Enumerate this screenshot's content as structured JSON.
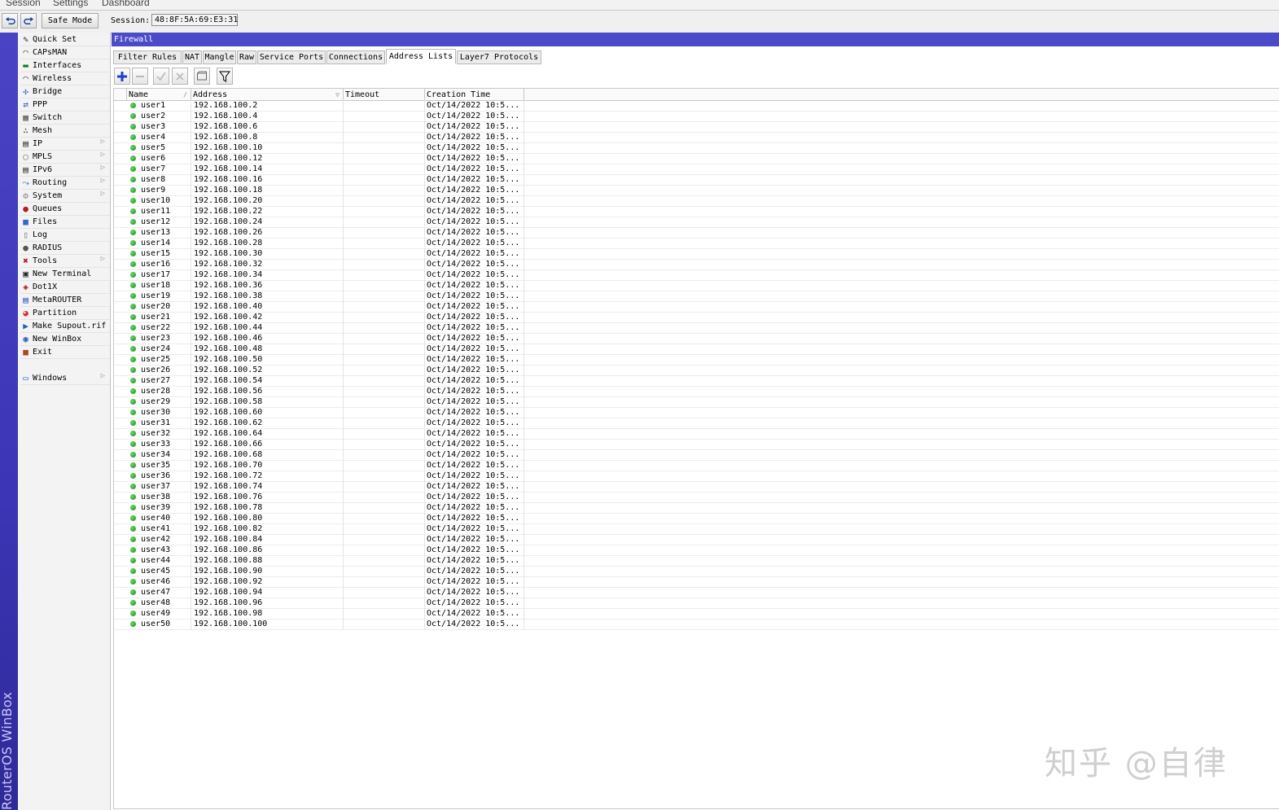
{
  "menu": [
    "Session",
    "Settings",
    "Dashboard"
  ],
  "toolbar": {
    "safe_mode": "Safe Mode",
    "session_label": "Session:",
    "session_value": "48:8F:5A:69:E3:31"
  },
  "brand": "RouterOS WinBox",
  "sidebar": [
    {
      "label": "Quick Set",
      "icon": "quick-set-icon",
      "sub": false
    },
    {
      "label": "CAPsMAN",
      "icon": "capsman-icon",
      "sub": false
    },
    {
      "label": "Interfaces",
      "icon": "interfaces-icon",
      "sub": false
    },
    {
      "label": "Wireless",
      "icon": "wireless-icon",
      "sub": false
    },
    {
      "label": "Bridge",
      "icon": "bridge-icon",
      "sub": false
    },
    {
      "label": "PPP",
      "icon": "ppp-icon",
      "sub": false
    },
    {
      "label": "Switch",
      "icon": "switch-icon",
      "sub": false
    },
    {
      "label": "Mesh",
      "icon": "mesh-icon",
      "sub": false
    },
    {
      "label": "IP",
      "icon": "ip-icon",
      "sub": true
    },
    {
      "label": "MPLS",
      "icon": "mpls-icon",
      "sub": true
    },
    {
      "label": "IPv6",
      "icon": "ipv6-icon",
      "sub": true
    },
    {
      "label": "Routing",
      "icon": "routing-icon",
      "sub": true
    },
    {
      "label": "System",
      "icon": "system-icon",
      "sub": true
    },
    {
      "label": "Queues",
      "icon": "queues-icon",
      "sub": false
    },
    {
      "label": "Files",
      "icon": "files-icon",
      "sub": false
    },
    {
      "label": "Log",
      "icon": "log-icon",
      "sub": false
    },
    {
      "label": "RADIUS",
      "icon": "radius-icon",
      "sub": false
    },
    {
      "label": "Tools",
      "icon": "tools-icon",
      "sub": true
    },
    {
      "label": "New Terminal",
      "icon": "terminal-icon",
      "sub": false
    },
    {
      "label": "Dot1X",
      "icon": "dot1x-icon",
      "sub": false
    },
    {
      "label": "MetaROUTER",
      "icon": "metarouter-icon",
      "sub": false
    },
    {
      "label": "Partition",
      "icon": "partition-icon",
      "sub": false
    },
    {
      "label": "Make Supout.rif",
      "icon": "supout-icon",
      "sub": false
    },
    {
      "label": "New WinBox",
      "icon": "winbox-icon",
      "sub": false
    },
    {
      "label": "Exit",
      "icon": "exit-icon",
      "sub": false
    }
  ],
  "sidebar_windows": {
    "label": "Windows",
    "icon": "windows-icon",
    "sub": true
  },
  "window": {
    "title": "Firewall",
    "tabs": [
      "Filter Rules",
      "NAT",
      "Mangle",
      "Raw",
      "Service Ports",
      "Connections",
      "Address Lists",
      "Layer7 Protocols"
    ],
    "active_tab": "Address Lists"
  },
  "table": {
    "columns": [
      "Name",
      "Address",
      "Timeout",
      "Creation Time"
    ],
    "rows": [
      {
        "name": "user1",
        "address": "192.168.100.2",
        "timeout": "",
        "created": "Oct/14/2022 10:5..."
      },
      {
        "name": "user2",
        "address": "192.168.100.4",
        "timeout": "",
        "created": "Oct/14/2022 10:5..."
      },
      {
        "name": "user3",
        "address": "192.168.100.6",
        "timeout": "",
        "created": "Oct/14/2022 10:5..."
      },
      {
        "name": "user4",
        "address": "192.168.100.8",
        "timeout": "",
        "created": "Oct/14/2022 10:5..."
      },
      {
        "name": "user5",
        "address": "192.168.100.10",
        "timeout": "",
        "created": "Oct/14/2022 10:5..."
      },
      {
        "name": "user6",
        "address": "192.168.100.12",
        "timeout": "",
        "created": "Oct/14/2022 10:5..."
      },
      {
        "name": "user7",
        "address": "192.168.100.14",
        "timeout": "",
        "created": "Oct/14/2022 10:5..."
      },
      {
        "name": "user8",
        "address": "192.168.100.16",
        "timeout": "",
        "created": "Oct/14/2022 10:5..."
      },
      {
        "name": "user9",
        "address": "192.168.100.18",
        "timeout": "",
        "created": "Oct/14/2022 10:5..."
      },
      {
        "name": "user10",
        "address": "192.168.100.20",
        "timeout": "",
        "created": "Oct/14/2022 10:5..."
      },
      {
        "name": "user11",
        "address": "192.168.100.22",
        "timeout": "",
        "created": "Oct/14/2022 10:5..."
      },
      {
        "name": "user12",
        "address": "192.168.100.24",
        "timeout": "",
        "created": "Oct/14/2022 10:5..."
      },
      {
        "name": "user13",
        "address": "192.168.100.26",
        "timeout": "",
        "created": "Oct/14/2022 10:5..."
      },
      {
        "name": "user14",
        "address": "192.168.100.28",
        "timeout": "",
        "created": "Oct/14/2022 10:5..."
      },
      {
        "name": "user15",
        "address": "192.168.100.30",
        "timeout": "",
        "created": "Oct/14/2022 10:5..."
      },
      {
        "name": "user16",
        "address": "192.168.100.32",
        "timeout": "",
        "created": "Oct/14/2022 10:5..."
      },
      {
        "name": "user17",
        "address": "192.168.100.34",
        "timeout": "",
        "created": "Oct/14/2022 10:5..."
      },
      {
        "name": "user18",
        "address": "192.168.100.36",
        "timeout": "",
        "created": "Oct/14/2022 10:5..."
      },
      {
        "name": "user19",
        "address": "192.168.100.38",
        "timeout": "",
        "created": "Oct/14/2022 10:5..."
      },
      {
        "name": "user20",
        "address": "192.168.100.40",
        "timeout": "",
        "created": "Oct/14/2022 10:5..."
      },
      {
        "name": "user21",
        "address": "192.168.100.42",
        "timeout": "",
        "created": "Oct/14/2022 10:5..."
      },
      {
        "name": "user22",
        "address": "192.168.100.44",
        "timeout": "",
        "created": "Oct/14/2022 10:5..."
      },
      {
        "name": "user23",
        "address": "192.168.100.46",
        "timeout": "",
        "created": "Oct/14/2022 10:5..."
      },
      {
        "name": "user24",
        "address": "192.168.100.48",
        "timeout": "",
        "created": "Oct/14/2022 10:5..."
      },
      {
        "name": "user25",
        "address": "192.168.100.50",
        "timeout": "",
        "created": "Oct/14/2022 10:5..."
      },
      {
        "name": "user26",
        "address": "192.168.100.52",
        "timeout": "",
        "created": "Oct/14/2022 10:5..."
      },
      {
        "name": "user27",
        "address": "192.168.100.54",
        "timeout": "",
        "created": "Oct/14/2022 10:5..."
      },
      {
        "name": "user28",
        "address": "192.168.100.56",
        "timeout": "",
        "created": "Oct/14/2022 10:5..."
      },
      {
        "name": "user29",
        "address": "192.168.100.58",
        "timeout": "",
        "created": "Oct/14/2022 10:5..."
      },
      {
        "name": "user30",
        "address": "192.168.100.60",
        "timeout": "",
        "created": "Oct/14/2022 10:5..."
      },
      {
        "name": "user31",
        "address": "192.168.100.62",
        "timeout": "",
        "created": "Oct/14/2022 10:5..."
      },
      {
        "name": "user32",
        "address": "192.168.100.64",
        "timeout": "",
        "created": "Oct/14/2022 10:5..."
      },
      {
        "name": "user33",
        "address": "192.168.100.66",
        "timeout": "",
        "created": "Oct/14/2022 10:5..."
      },
      {
        "name": "user34",
        "address": "192.168.100.68",
        "timeout": "",
        "created": "Oct/14/2022 10:5..."
      },
      {
        "name": "user35",
        "address": "192.168.100.70",
        "timeout": "",
        "created": "Oct/14/2022 10:5..."
      },
      {
        "name": "user36",
        "address": "192.168.100.72",
        "timeout": "",
        "created": "Oct/14/2022 10:5..."
      },
      {
        "name": "user37",
        "address": "192.168.100.74",
        "timeout": "",
        "created": "Oct/14/2022 10:5..."
      },
      {
        "name": "user38",
        "address": "192.168.100.76",
        "timeout": "",
        "created": "Oct/14/2022 10:5..."
      },
      {
        "name": "user39",
        "address": "192.168.100.78",
        "timeout": "",
        "created": "Oct/14/2022 10:5..."
      },
      {
        "name": "user40",
        "address": "192.168.100.80",
        "timeout": "",
        "created": "Oct/14/2022 10:5..."
      },
      {
        "name": "user41",
        "address": "192.168.100.82",
        "timeout": "",
        "created": "Oct/14/2022 10:5..."
      },
      {
        "name": "user42",
        "address": "192.168.100.84",
        "timeout": "",
        "created": "Oct/14/2022 10:5..."
      },
      {
        "name": "user43",
        "address": "192.168.100.86",
        "timeout": "",
        "created": "Oct/14/2022 10:5..."
      },
      {
        "name": "user44",
        "address": "192.168.100.88",
        "timeout": "",
        "created": "Oct/14/2022 10:5..."
      },
      {
        "name": "user45",
        "address": "192.168.100.90",
        "timeout": "",
        "created": "Oct/14/2022 10:5..."
      },
      {
        "name": "user46",
        "address": "192.168.100.92",
        "timeout": "",
        "created": "Oct/14/2022 10:5..."
      },
      {
        "name": "user47",
        "address": "192.168.100.94",
        "timeout": "",
        "created": "Oct/14/2022 10:5..."
      },
      {
        "name": "user48",
        "address": "192.168.100.96",
        "timeout": "",
        "created": "Oct/14/2022 10:5..."
      },
      {
        "name": "user49",
        "address": "192.168.100.98",
        "timeout": "",
        "created": "Oct/14/2022 10:5..."
      },
      {
        "name": "user50",
        "address": "192.168.100.100",
        "timeout": "",
        "created": "Oct/14/2022 10:5..."
      }
    ]
  },
  "watermark": "知乎 @自律",
  "colors": {
    "title_bar": "#4b4ac8",
    "brand_bar": "#3c35b5",
    "status_enabled": "#1a9a1a",
    "add_icon": "#1c3fd1"
  }
}
